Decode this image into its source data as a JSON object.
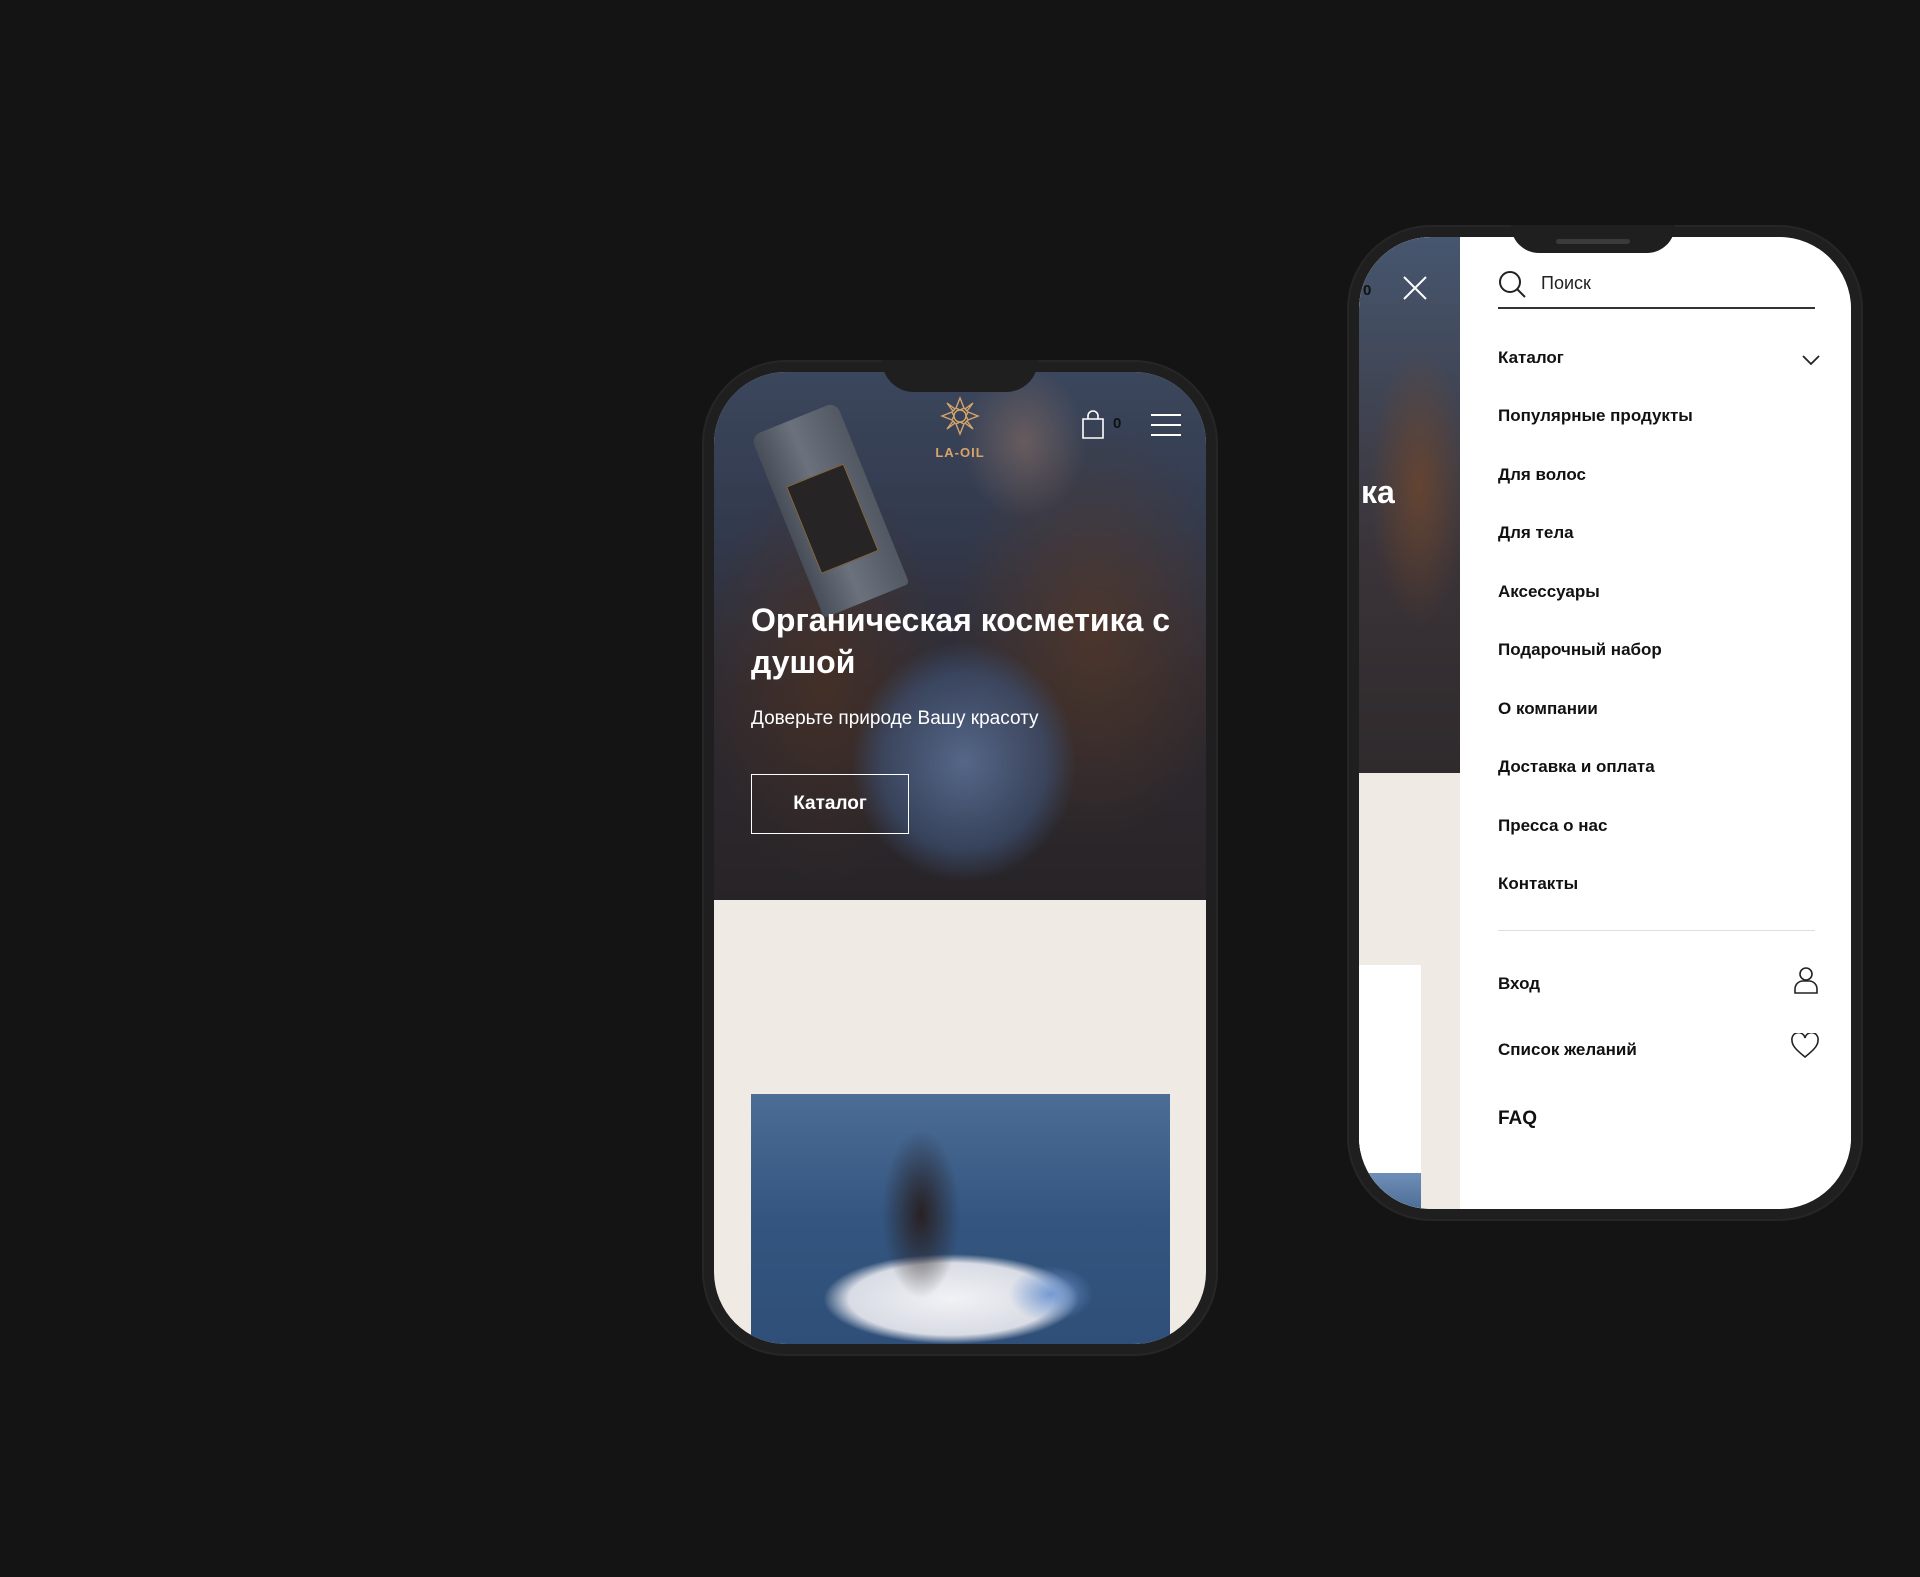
{
  "phone1": {
    "logo_text": "LA-OIL",
    "cart_count": "0",
    "hero_title": "Органическая косметика с душой",
    "hero_subtitle": "Доверьте природе Вашу красоту",
    "catalog_button": "Каталог"
  },
  "phone2": {
    "behind": {
      "cart_count": "0",
      "title_fragment": "ка"
    },
    "search_placeholder": "Поиск",
    "menu": {
      "catalog": "Каталог",
      "popular": "Популярные продукты",
      "hair": "Для волос",
      "body": "Для тела",
      "accessories": "Аксессуары",
      "gift_set": "Подарочный набор",
      "about": "О компании",
      "delivery": "Доставка и оплата",
      "press": "Пресса о нас",
      "contacts": "Контакты",
      "login": "Вход",
      "wishlist": "Список желаний",
      "faq": "FAQ"
    }
  },
  "colors": {
    "background": "#141414",
    "accent_gold": "#d7a46a",
    "beige": "#efeae3"
  }
}
